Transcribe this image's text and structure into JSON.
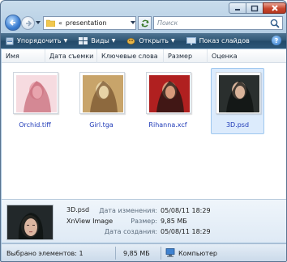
{
  "window": {
    "controls": [
      "minimize",
      "maximize",
      "close"
    ]
  },
  "navigation": {
    "breadcrumb_chevron": "«",
    "address_path": "presentation",
    "search_placeholder": "Поиск"
  },
  "command_bar": {
    "organize": "Упорядочить",
    "views": "Виды",
    "open": "Открыть",
    "slideshow": "Показ слайдов",
    "help": "?"
  },
  "columns": [
    "Имя",
    "Дата съемки",
    "Ключевые слова",
    "Размер",
    "Оценка"
  ],
  "files": [
    {
      "name": "Orchid.tiff",
      "selected": false,
      "colors": [
        "#f6dbe0",
        "#c86c7b",
        "#e8a4ad"
      ]
    },
    {
      "name": "Girl.tga",
      "selected": false,
      "colors": [
        "#c8a46a",
        "#7a5530",
        "#e7d3a7"
      ]
    },
    {
      "name": "Rihanna.xcf",
      "selected": false,
      "colors": [
        "#b02020",
        "#1c1412",
        "#d79a7a"
      ]
    },
    {
      "name": "3D.psd",
      "selected": true,
      "colors": [
        "#2a2f2e",
        "#0e1110",
        "#d9b39a"
      ]
    }
  ],
  "details": {
    "filename": "3D.psd",
    "type": "XnView Image",
    "modified_label": "Дата изменения:",
    "modified_value": "05/08/11 18:29",
    "size_label": "Размер:",
    "size_value": "9,85 МБ",
    "created_label": "Дата создания:",
    "created_value": "05/08/11 18:29"
  },
  "status": {
    "selected_count": "Выбрано элементов: 1",
    "size": "9,85 МБ",
    "location": "Компьютер"
  },
  "colors": {
    "link_blue": "#1f3ab8",
    "command_bar": "#2f5675",
    "selection_bg": "#dcebfc"
  }
}
